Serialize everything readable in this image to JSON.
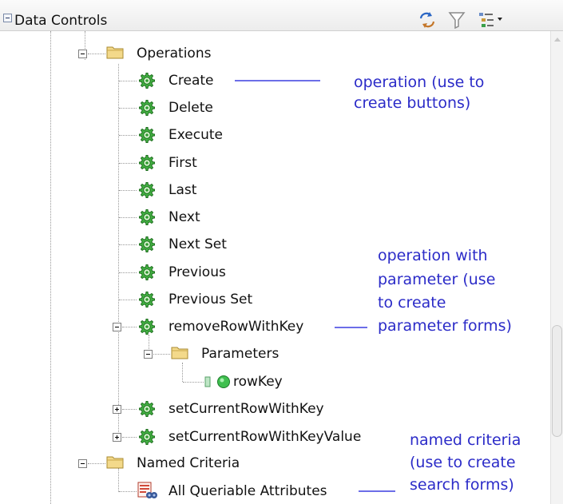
{
  "header": {
    "title": "Data Controls",
    "icons": [
      "refresh-icon",
      "filter-icon",
      "tree-view-options-icon"
    ]
  },
  "tree": {
    "operations": {
      "label": "Operations",
      "items": [
        "Create",
        "Delete",
        "Execute",
        "First",
        "Last",
        "Next",
        "Next Set",
        "Previous",
        "Previous Set"
      ],
      "remove_row": {
        "label": "removeRowWithKey",
        "parameters": {
          "label": "Parameters",
          "param": "rowKey"
        }
      },
      "set_current": "setCurrentRowWithKey",
      "set_current_value": "setCurrentRowWithKeyValue"
    },
    "named_criteria": {
      "label": "Named Criteria",
      "items": [
        "All Queriable Attributes"
      ]
    }
  },
  "annotations": {
    "operation": [
      "operation (use to",
      "create buttons)"
    ],
    "operation_with_parameter": [
      "operation with",
      "parameter (use",
      "to create",
      "parameter forms)"
    ],
    "named_criteria": [
      "named criteria",
      "(use to create",
      "search forms)"
    ]
  },
  "colors": {
    "annotation_text": "#2b2bc8",
    "annotation_line": "#6c6ee8",
    "gear": "#2e9a2e",
    "folder": "#e8c868"
  }
}
